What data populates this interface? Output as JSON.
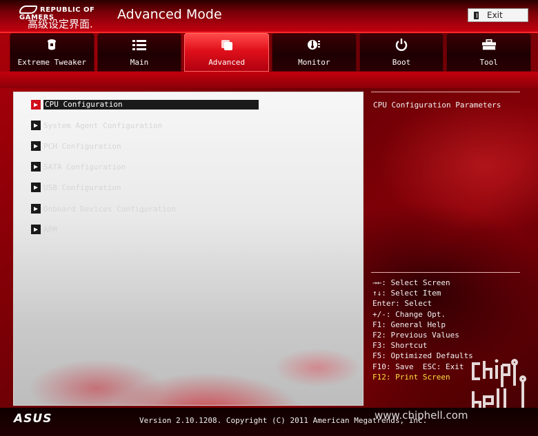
{
  "header": {
    "brand": "REPUBLIC OF GAMERS",
    "subtitle": "高级设定界面.",
    "mode_title": "Advanced Mode",
    "exit_label": "Exit"
  },
  "tabs": [
    {
      "label": "Extreme Tweaker",
      "icon": "tweaker-icon",
      "active": false
    },
    {
      "label": "Main",
      "icon": "list-icon",
      "active": false
    },
    {
      "label": "Advanced",
      "icon": "advanced-icon",
      "active": true
    },
    {
      "label": "Monitor",
      "icon": "thermometer-icon",
      "active": false
    },
    {
      "label": "Boot",
      "icon": "power-icon",
      "active": false
    },
    {
      "label": "Tool",
      "icon": "toolbox-icon",
      "active": false
    }
  ],
  "menu": [
    {
      "label": "CPU Configuration",
      "selected": true
    },
    {
      "label": "System Agent Configuration",
      "selected": false
    },
    {
      "label": "PCH Configuration",
      "selected": false
    },
    {
      "label": "SATA Configuration",
      "selected": false
    },
    {
      "label": "USB Configuration",
      "selected": false
    },
    {
      "label": "Onboard Devices Configuration",
      "selected": false
    },
    {
      "label": "APM",
      "selected": false
    }
  ],
  "help": {
    "title": "CPU Configuration Parameters"
  },
  "keys": [
    {
      "text": "→←: Select Screen",
      "highlight": false
    },
    {
      "text": "↑↓: Select Item",
      "highlight": false
    },
    {
      "text": "Enter: Select",
      "highlight": false
    },
    {
      "text": "+/-: Change Opt.",
      "highlight": false
    },
    {
      "text": "F1: General Help",
      "highlight": false
    },
    {
      "text": "F2: Previous Values",
      "highlight": false
    },
    {
      "text": "F3: Shortcut",
      "highlight": false
    },
    {
      "text": "F5: Optimized Defaults",
      "highlight": false
    },
    {
      "text": "F10: Save  ESC: Exit",
      "highlight": false
    },
    {
      "text": "F12: Print Screen",
      "highlight": true
    }
  ],
  "footer": {
    "logo": "ASUS",
    "version": "Version 2.10.1208. Copyright (C) 2011 American Megatrends, Inc.",
    "watermark": "www.chiphell.com",
    "watermark_brand": "chiphell"
  },
  "colors": {
    "accent_red": "#d0101a",
    "highlight_yellow": "#ffe040"
  }
}
